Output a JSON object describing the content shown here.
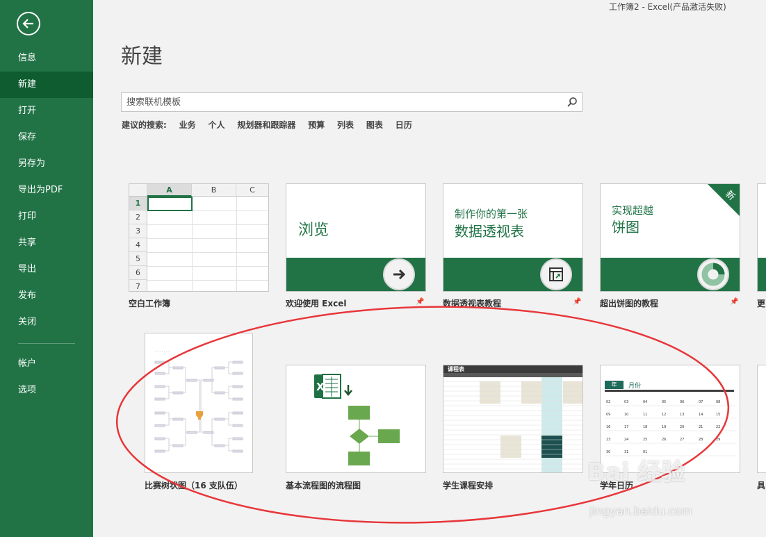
{
  "window": {
    "title": "工作簿2 - Excel(产品激活失败)"
  },
  "sidebar": {
    "items": [
      {
        "label": "信息"
      },
      {
        "label": "新建"
      },
      {
        "label": "打开"
      },
      {
        "label": "保存"
      },
      {
        "label": "另存为"
      },
      {
        "label": "导出为PDF"
      },
      {
        "label": "打印"
      },
      {
        "label": "共享"
      },
      {
        "label": "导出"
      },
      {
        "label": "发布"
      },
      {
        "label": "关闭"
      },
      {
        "label": "帐户"
      },
      {
        "label": "选项"
      }
    ],
    "active": "新建",
    "color": "#217346",
    "active_color": "#0e5c30"
  },
  "main": {
    "title": "新建",
    "search": {
      "placeholder": "搜索联机模板",
      "icon": "search-icon"
    },
    "suggested": {
      "label": "建议的搜索:",
      "terms": [
        "业务",
        "个人",
        "规划器和跟踪器",
        "预算",
        "列表",
        "图表",
        "日历"
      ]
    },
    "templates_row1": [
      {
        "label": "空白工作簿",
        "columns": [
          "A",
          "B",
          "C"
        ],
        "rows": [
          "1",
          "2",
          "3",
          "4",
          "5",
          "6",
          "7"
        ]
      },
      {
        "label": "欢迎使用 Excel",
        "text": "浏览"
      },
      {
        "label": "数据透视表教程",
        "text_line1": "制作你的第一张",
        "text_line2": "数据透视表"
      },
      {
        "label": "超出饼图的教程",
        "text_line1": "实现超越",
        "text_line2": "饼图",
        "badge": "新"
      },
      {
        "label": "更"
      }
    ],
    "templates_row2": [
      {
        "label": "比赛树状图（16 支队伍）"
      },
      {
        "label": "基本流程图的流程图"
      },
      {
        "label": "学生课程安排",
        "header": "课程表"
      },
      {
        "label": "学年日历",
        "header": "年",
        "subheader": "月份"
      },
      {
        "label": "具"
      }
    ],
    "accent_color": "#217346"
  },
  "watermark": {
    "brand": "Bai 经验",
    "url": "jingyan.baidu.com"
  }
}
